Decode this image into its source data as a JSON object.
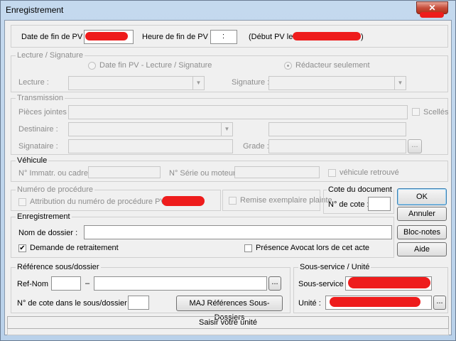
{
  "window": {
    "title": "Enregistrement",
    "close_glyph": "✕"
  },
  "pv": {
    "date_label": "Date de fin de PV :",
    "heure_label": "Heure de fin de PV :",
    "heure_value": ":",
    "debut_label": "(Début PV le :",
    "debut_close": ")"
  },
  "lecture": {
    "caption": "Lecture / Signature",
    "radio1": "Date fin PV - Lecture / Signature",
    "radio2": "Rédacteur seulement",
    "lecture_label": "Lecture :",
    "signature_label": "Signature :"
  },
  "transmission": {
    "caption": "Transmission",
    "pieces_label": "Pièces jointes :",
    "scelles_label": "Scellés",
    "destinaire_label": "Destinaire :",
    "signataire_label": "Signataire :",
    "grade_label": "Grade :",
    "browse_label": "..."
  },
  "vehicule": {
    "caption": "Véhicule",
    "immat_label": "N° Immatr. ou cadre :",
    "serie_label": "N° Série ou moteur :",
    "retrouve_label": "véhicule retrouvé"
  },
  "procedure": {
    "caption": "Numéro de procédure",
    "attribution_label": "Attribution du numéro de procédure PV n°",
    "remise_label": "Remise exemplaire plainte"
  },
  "cote": {
    "caption": "Cote du document",
    "label": "N° de cote :"
  },
  "buttons": {
    "ok": "OK",
    "annuler": "Annuler",
    "blocnotes": "Bloc-notes",
    "aide": "Aide",
    "maj": "MAJ Références Sous-Dossiers"
  },
  "enregistrement": {
    "caption": "Enregistrement",
    "nom_label": "Nom de dossier :",
    "retraitement_label": "Demande de retraitement",
    "retraitement_mark": "✔",
    "avocat_label": "Présence Avocat lors de cet acte"
  },
  "reference": {
    "caption": "Référence sous/dossier",
    "refnom_label": "Ref-Nom :",
    "dash": "–",
    "cote_label": "N° de cote dans le sous/dossier :",
    "browse_label": "..."
  },
  "sousservice": {
    "caption": "Sous-service / Unité",
    "sous_label": "Sous-service :",
    "unite_label": "Unité :",
    "browse_label": "..."
  },
  "status": {
    "text": "Saisir votre unité"
  },
  "colors": {
    "redaction": "#ee1c1c",
    "title_bar": "#c4d9ee",
    "close_button": "#c74f3c"
  }
}
